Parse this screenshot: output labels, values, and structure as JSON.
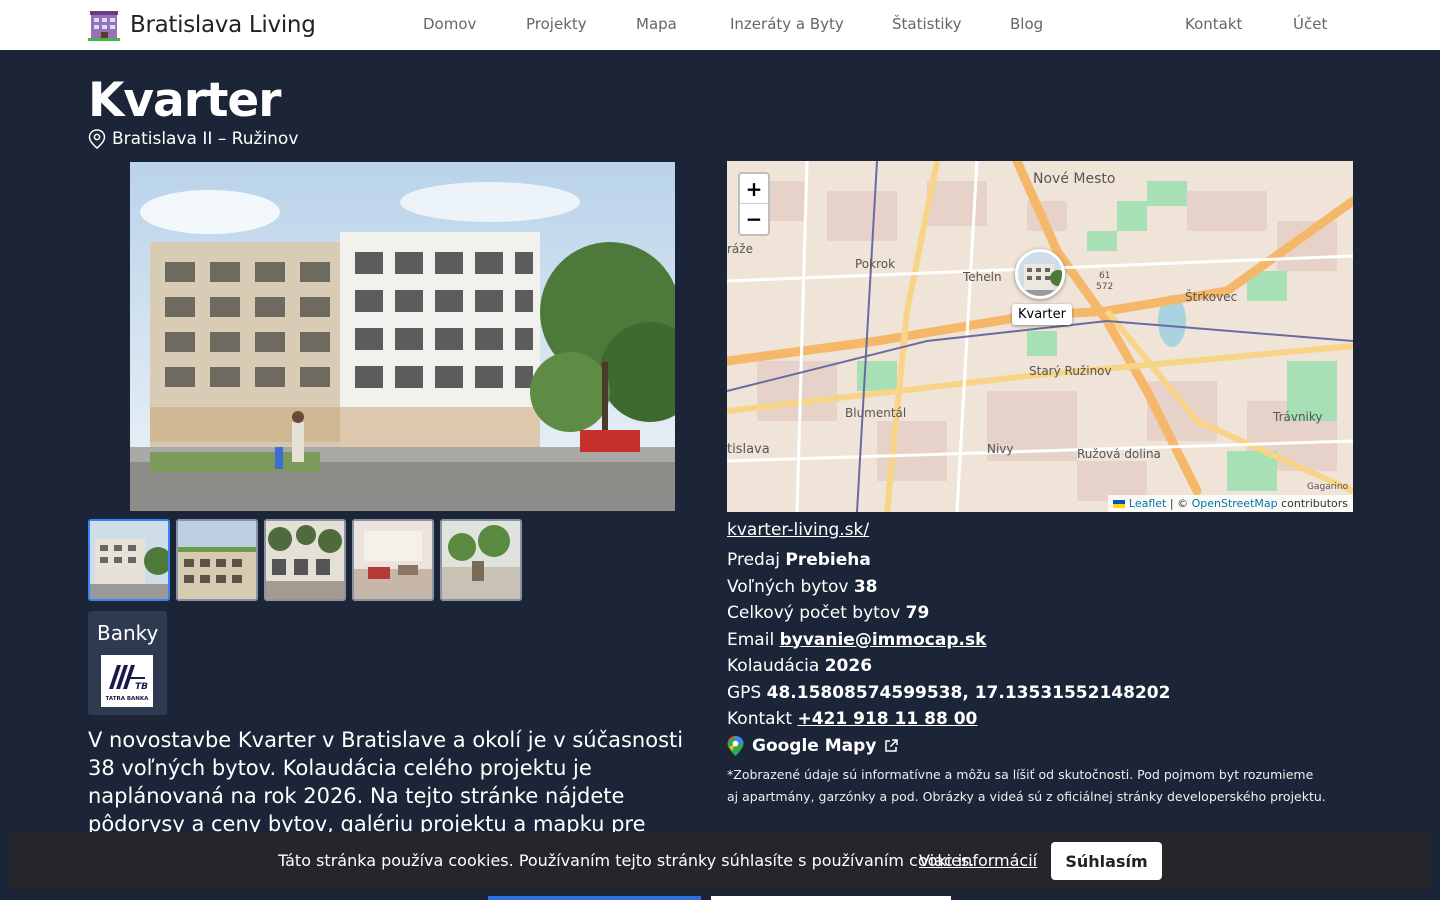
{
  "nav": {
    "brand": "Bratislava Living",
    "links": [
      "Domov",
      "Projekty",
      "Mapa",
      "Inzeráty a Byty",
      "Štatistiky",
      "Blog"
    ],
    "right_links": [
      "Kontakt",
      "Účet"
    ]
  },
  "project": {
    "title": "Kvarter",
    "location": "Bratislava II – Ružinov"
  },
  "gallery": {
    "thumb_count": 5
  },
  "banks": {
    "title": "Banky",
    "bank_name": "TATRA BANKA"
  },
  "description": "V novostavbe Kvarter v Bratislave a okolí je v súčasnosti 38 voľných bytov. Kolaudácia celého projektu je naplánovaná na rok 2026. Na tejto stránke nájdete pôdorysy a ceny bytov, galériu projektu a mapku pre",
  "map": {
    "zoom_in": "+",
    "zoom_out": "−",
    "marker_label": "Kvarter",
    "attribution_leaflet": "Leaflet",
    "attribution_sep": " | © ",
    "attribution_osm": "OpenStreetMap",
    "attribution_tail": " contributors",
    "place_labels": [
      "Nové Mesto",
      "Pokrok",
      "Teheln",
      "Štrkovec",
      "Starý Ružinov",
      "Blumentál",
      "Trávniky",
      "Nivy",
      "Ružová dolina",
      "tislava",
      "ráže",
      "61",
      "572",
      "Gagarino"
    ]
  },
  "details": {
    "website": "kvarter-living.sk/",
    "sale_label": "Predaj ",
    "sale_value": "Prebieha",
    "free_label": "Voľných bytov ",
    "free_value": "38",
    "total_label": "Celkový počet bytov ",
    "total_value": "79",
    "email_label": "Email ",
    "email_value": "byvanie@immocap.sk",
    "completion_label": "Kolaudácia ",
    "completion_value": "2026",
    "gps_label": "GPS ",
    "gps_value": "48.15808574599538, 17.13531552148202",
    "contact_label": "Kontakt ",
    "contact_value": "+421 918 11 88 00",
    "gmaps_label": "Google Mapy",
    "note": "*Zobrazené údaje sú informatívne a môžu sa líšiť od skutočnosti. Pod pojmom byt rozumieme aj apartmány, garzónky a pod. Obrázky a videá sú z oficiálnej stránky developerského projektu."
  },
  "cookie": {
    "text": "Táto stránka používa cookies. Používaním tejto stránky súhlasíte s používaním cookies.",
    "link": "Viac informácií",
    "button": "Súhlasím"
  },
  "colors": {
    "background": "#1c2538",
    "accent": "#3b82f6",
    "map_road": "#f5b86a",
    "map_green": "#a8e0b5"
  }
}
